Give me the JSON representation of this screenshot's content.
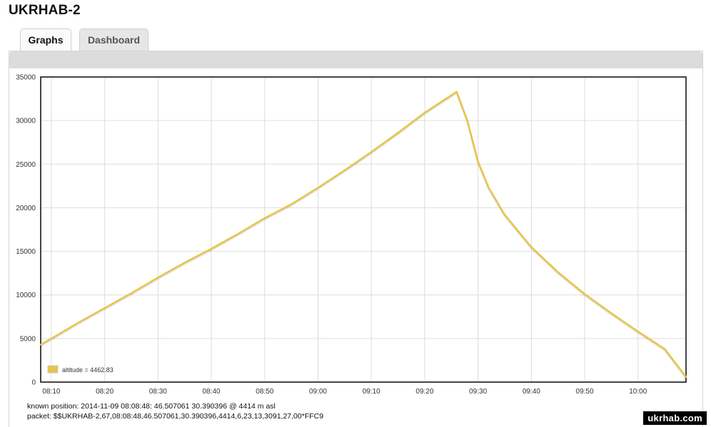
{
  "page_title": "UKRHAB-2",
  "tabs": [
    {
      "label": "Graphs",
      "active": true
    },
    {
      "label": "Dashboard",
      "active": false
    }
  ],
  "info": {
    "known_position": "known position: 2014-11-09 08:08:48: 46.507061 30.390396 @ 4414 m asl",
    "packet": "packet: $$UKRHAB-2,67,08:08:48,46.507061,30.390396,4414,6,23,13,3091,27,00*FFC9"
  },
  "watermark": "ukrhab.com",
  "colors": {
    "series": "#e8c547",
    "grid": "#dddddd",
    "frame": "#444444"
  },
  "chart_data": {
    "type": "line",
    "x_unit": "time",
    "x_range": [
      "08:08",
      "10:09"
    ],
    "y_range": [
      0,
      35000
    ],
    "x_ticks": [
      "08:10",
      "08:20",
      "08:30",
      "08:40",
      "08:50",
      "09:00",
      "09:10",
      "09:20",
      "09:30",
      "09:40",
      "09:50",
      "10:00"
    ],
    "y_ticks": [
      0,
      5000,
      10000,
      15000,
      20000,
      25000,
      30000,
      35000
    ],
    "grid": true,
    "legend_placement": "bottom-left",
    "series": [
      {
        "name": "altitude",
        "legend_label": "altitude = 4462.83",
        "points": [
          [
            "08:08",
            4300
          ],
          [
            "08:10",
            5000
          ],
          [
            "08:15",
            6800
          ],
          [
            "08:20",
            8500
          ],
          [
            "08:25",
            10200
          ],
          [
            "08:30",
            12000
          ],
          [
            "08:35",
            13700
          ],
          [
            "08:40",
            15300
          ],
          [
            "08:45",
            17000
          ],
          [
            "08:50",
            18800
          ],
          [
            "08:55",
            20400
          ],
          [
            "09:00",
            22300
          ],
          [
            "09:05",
            24300
          ],
          [
            "09:10",
            26400
          ],
          [
            "09:15",
            28600
          ],
          [
            "09:20",
            30900
          ],
          [
            "09:26",
            33300
          ],
          [
            "09:28",
            30000
          ],
          [
            "09:30",
            25300
          ],
          [
            "09:32",
            22300
          ],
          [
            "09:35",
            19200
          ],
          [
            "09:40",
            15500
          ],
          [
            "09:45",
            12600
          ],
          [
            "09:50",
            10100
          ],
          [
            "09:55",
            7900
          ],
          [
            "10:00",
            5800
          ],
          [
            "10:05",
            3800
          ],
          [
            "10:09",
            600
          ]
        ]
      }
    ]
  }
}
